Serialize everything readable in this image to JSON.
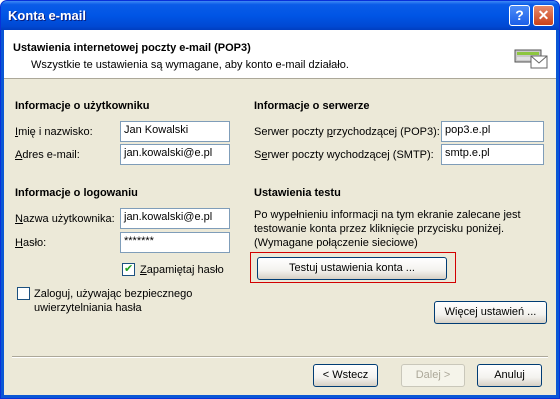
{
  "window": {
    "title": "Konta e-mail",
    "help_label": "?",
    "close_label": "✕"
  },
  "header": {
    "title": "Ustawienia internetowej poczty e-mail (POP3)",
    "subtitle": "Wszystkie te ustawienia są wymagane, aby konto e-mail działało.",
    "icon": "mail-server-icon"
  },
  "user_info": {
    "heading": "Informacje o użytkowniku",
    "name_label_ul": "I",
    "name_label_rest": "mię i nazwisko:",
    "name_value": "Jan Kowalski",
    "email_label_ul": "A",
    "email_label_rest": "dres e-mail:",
    "email_value": "jan.kowalski@e.pl"
  },
  "server_info": {
    "heading": "Informacje o serwerze",
    "in_label_a": "Serwer poczty ",
    "in_label_ul": "p",
    "in_label_b": "rzychodzącej (POP3):",
    "in_value": "pop3.e.pl",
    "out_label_a": "S",
    "out_label_ul": "e",
    "out_label_b": "rwer poczty wychodzącej (SMTP):",
    "out_value": "smtp.e.pl"
  },
  "logon_info": {
    "heading": "Informacje o logowaniu",
    "user_label_ul": "N",
    "user_label_rest": "azwa użytkownika:",
    "user_value": "jan.kowalski@e.pl",
    "pass_label_ul": "H",
    "pass_label_rest": "asło:",
    "pass_value": "*******",
    "remember_label_ul": "Z",
    "remember_label_rest": "apamiętaj hasło",
    "remember_checked": true,
    "spa_label_line1": "Zaloguj, używając bezpiecznego",
    "spa_label_line2": "uwierzytelniania hasła",
    "spa_checked": false
  },
  "test_settings": {
    "heading": "Ustawienia testu",
    "description_line1": "Po wypełnieniu informacji na tym ekranie zalecane jest",
    "description_line2": "testowanie konta przez kliknięcie przycisku poniżej.",
    "description_line3": "(Wymagane połączenie sieciowe)",
    "test_button": "Testuj ustawienia konta ...",
    "more_button": "Więcej ustawień ..."
  },
  "footer": {
    "back": "< Wstecz",
    "next": "Dalej >",
    "cancel": "Anuluj"
  },
  "colors": {
    "titlebar": "#0055e5",
    "face": "#ece9d8",
    "highlight": "#d20000",
    "border": "#7f9db9"
  }
}
